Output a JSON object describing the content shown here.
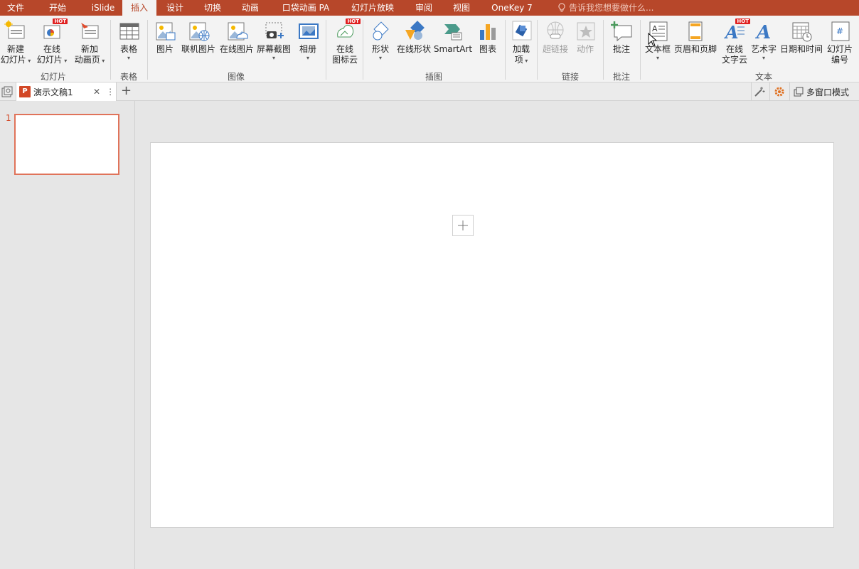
{
  "tabs": [
    "文件",
    "开始",
    "iSlide",
    "插入",
    "设计",
    "切换",
    "动画",
    "口袋动画 PA",
    "幻灯片放映",
    "审阅",
    "视图",
    "OneKey 7"
  ],
  "active_tab": "插入",
  "tell_me": "告诉我您想要做什么...",
  "ribbon": {
    "new_slide": [
      "新建",
      "幻灯片"
    ],
    "online_slide": [
      "在线",
      "幻灯片"
    ],
    "new_anim_page": [
      "新加",
      "动画页"
    ],
    "table": "表格",
    "picture": "图片",
    "online_picture_linked": "联机图片",
    "online_picture": "在线图片",
    "screenshot": "屏幕截图",
    "album": "相册",
    "icon_cloud": [
      "在线",
      "图标云"
    ],
    "shapes": "形状",
    "online_shapes": "在线形状",
    "smartart": "SmartArt",
    "chart": "图表",
    "addins": [
      "加载",
      "项"
    ],
    "hyperlink": "超链接",
    "action": "动作",
    "comment": "批注",
    "textbox": "文本框",
    "header_footer": "页眉和页脚",
    "word_cloud": [
      "在线",
      "文字云"
    ],
    "wordart": "艺术字",
    "datetime": "日期和时间",
    "slide_number": [
      "幻灯片",
      "编号"
    ],
    "hot": "HOT",
    "groups": {
      "slides": "幻灯片",
      "tables": "表格",
      "images": "图像",
      "illustrations": "插图",
      "links": "链接",
      "comments": "批注",
      "text": "文本"
    }
  },
  "docbar": {
    "doc_name": "演示文稿1",
    "close": "✕",
    "more": "⋮",
    "add": "+",
    "multiwindow": "多窗口模式"
  },
  "thumbs": {
    "slide_number": "1"
  },
  "colors": {
    "brand": "#b7472a",
    "ribbon_bg": "#f3f3f3",
    "selection": "#e0735a"
  }
}
